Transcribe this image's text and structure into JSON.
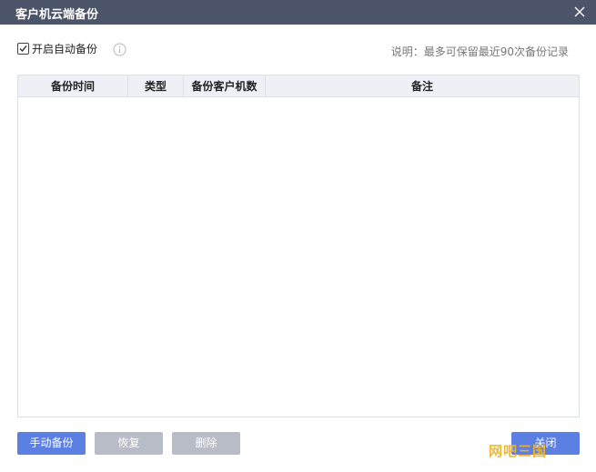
{
  "window": {
    "title": "客户机云端备份",
    "close_icon": "close-icon"
  },
  "options": {
    "auto_backup_label": "开启自动备份",
    "auto_backup_checked": true,
    "info_icon": "info-circle-icon",
    "note": "说明：最多可保留最近90次备份记录"
  },
  "table": {
    "columns": [
      "备份时间",
      "类型",
      "备份客户机数",
      "备注"
    ],
    "rows": []
  },
  "buttons": {
    "manual_backup": "手动备份",
    "restore": "恢复",
    "delete": "删除",
    "close": "关闭"
  },
  "watermark": {
    "text": "网吧三国"
  },
  "colors": {
    "titlebar": "#4b5468",
    "primary": "#5b7fe3",
    "disabled": "#b8bcc6",
    "header_bg": "#eef0f5",
    "border": "#dcdfe6",
    "watermark": "#f0b429"
  }
}
